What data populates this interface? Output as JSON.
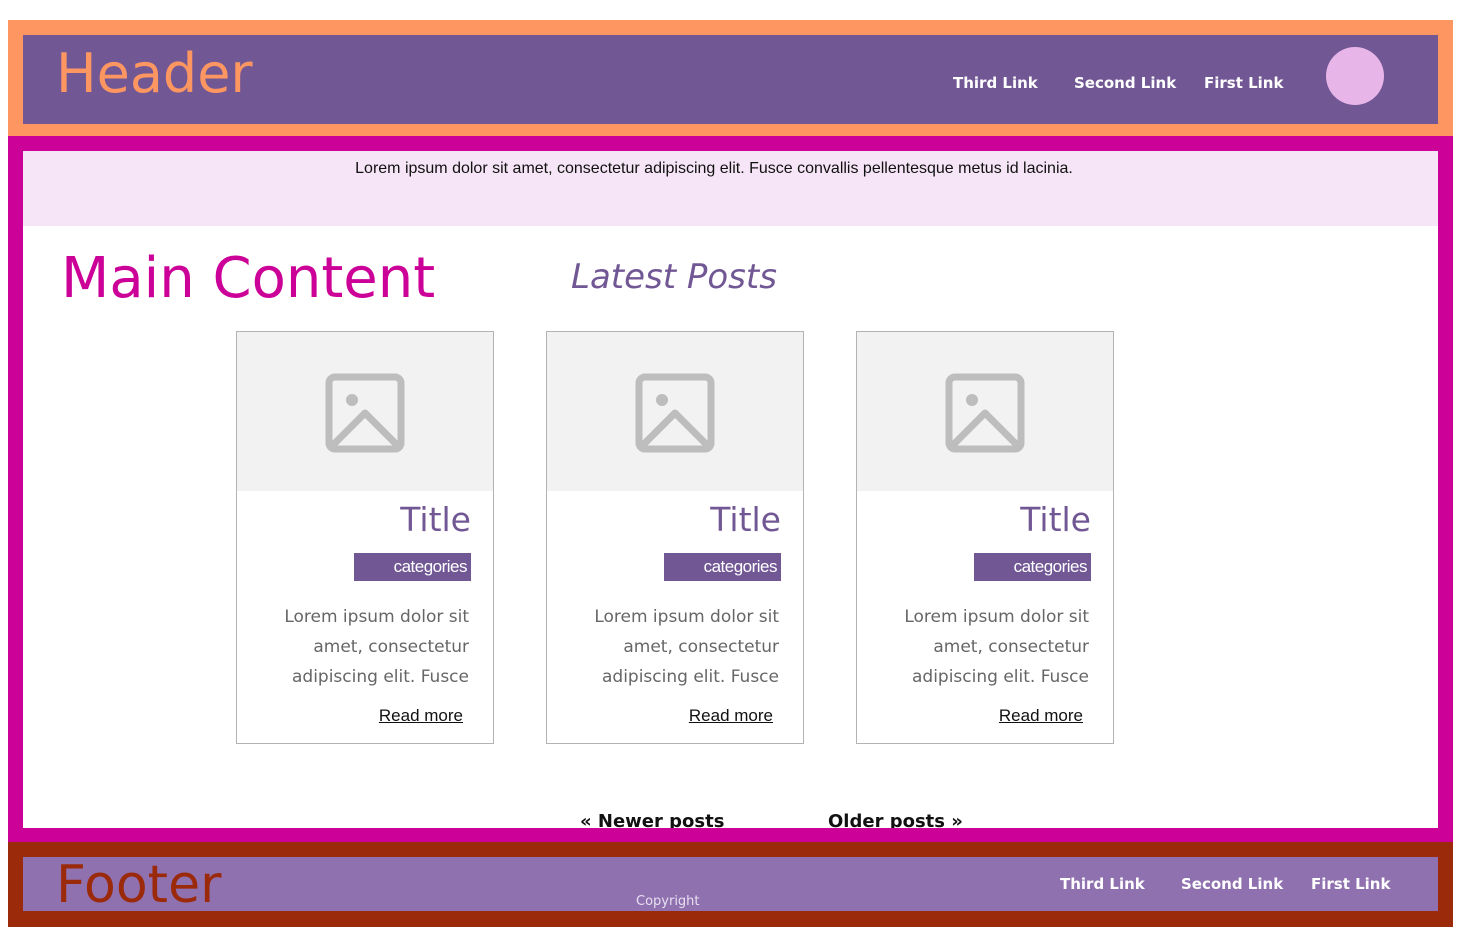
{
  "header": {
    "title": "Header",
    "nav": [
      "Third Link",
      "Second Link",
      "First Link"
    ]
  },
  "main": {
    "intro": "Lorem ipsum dolor sit amet, consectetur adipiscing elit. Fusce convallis pellentesque metus id lacinia.",
    "title": "Main Content",
    "section_title": "Latest Posts",
    "posts": [
      {
        "title": "Title",
        "category": "categories",
        "excerpt": "Lorem ipsum dolor sit amet, consectetur adipiscing elit. Fusce",
        "read_more": "Read more",
        "image_icon": "image-placeholder-icon"
      },
      {
        "title": "Title",
        "category": "categories",
        "excerpt": "Lorem ipsum dolor sit amet, consectetur adipiscing elit. Fusce",
        "read_more": "Read more",
        "image_icon": "image-placeholder-icon"
      },
      {
        "title": "Title",
        "category": "categories",
        "excerpt": "Lorem ipsum dolor sit amet, consectetur adipiscing elit. Fusce",
        "read_more": "Read more",
        "image_icon": "image-placeholder-icon"
      }
    ],
    "pagination": {
      "newer": "« Newer posts",
      "older": "Older posts »"
    }
  },
  "footer": {
    "title": "Footer",
    "copyright": "Copyright",
    "nav": [
      "Third Link",
      "Second Link",
      "First Link"
    ]
  },
  "colors": {
    "header_border": "#fd9661",
    "header_bg": "#715895",
    "main_border": "#cc0198",
    "intro_bg": "#f6e5f6",
    "footer_border": "#9b2a0b",
    "footer_bg": "#8f71b0",
    "avatar": "#e8b5e8"
  }
}
